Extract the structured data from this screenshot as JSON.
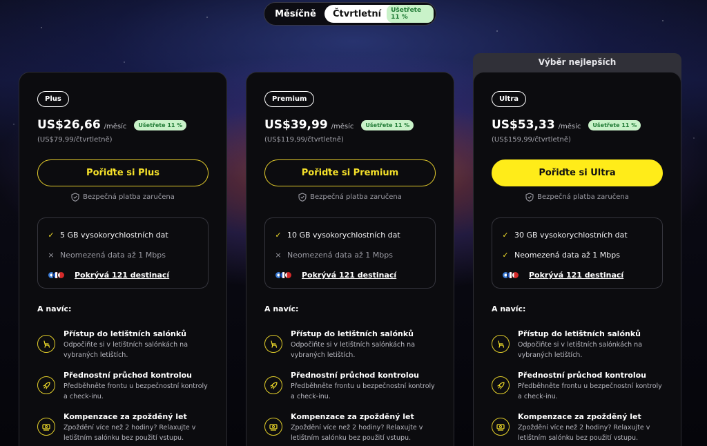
{
  "toggle": {
    "monthly_label": "Měsíčně",
    "quarterly_label": "Čtvrtletní",
    "quarterly_badge": "Ušetřete 11 %"
  },
  "best_banner": "Výběr nejlepších",
  "plans": [
    {
      "tier": "Plus",
      "price": "US$26,66",
      "per": "/měsíc",
      "save_badge": "Ušetřete 11 %",
      "sub_price": "(US$79,99/čtvrtletně)",
      "cta": "Pořiďte si Plus",
      "cta_style": "outline",
      "secure": "Bezpečná platba zaručena",
      "features": [
        {
          "mark": "✓",
          "state": "on",
          "text": "5 GB vysokorychlostních dat"
        },
        {
          "mark": "×",
          "state": "off",
          "text": "Neomezená data až 1 Mbps"
        },
        {
          "mark": "flags",
          "state": "on",
          "text": "Pokrývá 121 destinací"
        }
      ],
      "extra_title": "A navíc:",
      "extras": [
        {
          "icon": "seat-icon",
          "title": "Přístup do letištních salónků",
          "desc": "Odpočiňte si v letištních salónkách na vybraných letištích."
        },
        {
          "icon": "rocket-icon",
          "title": "Přednostní průchod kontrolou",
          "desc": "Předběhněte frontu u bezpečnostní kontroly a check-inu."
        },
        {
          "icon": "money-icon",
          "title": "Kompenzace za zpožděný let",
          "desc": "Zpoždění více než 2 hodiny? Relaxujte v letištním salónku bez použití vstupu."
        }
      ]
    },
    {
      "tier": "Premium",
      "price": "US$39,99",
      "per": "/měsíc",
      "save_badge": "Ušetřete 11 %",
      "sub_price": "(US$119,99/čtvrtletně)",
      "cta": "Pořiďte si Premium",
      "cta_style": "outline",
      "secure": "Bezpečná platba zaručena",
      "features": [
        {
          "mark": "✓",
          "state": "on",
          "text": "10 GB vysokorychlostních dat"
        },
        {
          "mark": "×",
          "state": "off",
          "text": "Neomezená data až 1 Mbps"
        },
        {
          "mark": "flags",
          "state": "on",
          "text": "Pokrývá 121 destinací"
        }
      ],
      "extra_title": "A navíc:",
      "extras": [
        {
          "icon": "seat-icon",
          "title": "Přístup do letištních salónků",
          "desc": "Odpočiňte si v letištních salónkách na vybraných letištích."
        },
        {
          "icon": "rocket-icon",
          "title": "Přednostní průchod kontrolou",
          "desc": "Předběhněte frontu u bezpečnostní kontroly a check-inu."
        },
        {
          "icon": "money-icon",
          "title": "Kompenzace za zpožděný let",
          "desc": "Zpoždění více než 2 hodiny? Relaxujte v letištním salónku bez použití vstupu."
        }
      ]
    },
    {
      "tier": "Ultra",
      "price": "US$53,33",
      "per": "/měsíc",
      "save_badge": "Ušetřete 11 %",
      "sub_price": "(US$159,99/čtvrtletně)",
      "cta": "Pořiďte si Ultra",
      "cta_style": "filled",
      "secure": "Bezpečná platba zaručena",
      "features": [
        {
          "mark": "✓",
          "state": "on",
          "text": "30 GB vysokorychlostních dat"
        },
        {
          "mark": "✓",
          "state": "on",
          "text": "Neomezená data až 1 Mbps"
        },
        {
          "mark": "flags",
          "state": "on",
          "text": "Pokrývá 121 destinací"
        }
      ],
      "extra_title": "A navíc:",
      "extras": [
        {
          "icon": "seat-icon",
          "title": "Přístup do letištních salónků",
          "desc": "Odpočiňte si v letištních salónkách na vybraných letištích."
        },
        {
          "icon": "rocket-icon",
          "title": "Přednostní průchod kontrolou",
          "desc": "Předběhněte frontu u bezpečnostní kontroly a check-inu."
        },
        {
          "icon": "money-icon",
          "title": "Kompenzace za zpožděný let",
          "desc": "Zpoždění více než 2 hodiny? Relaxujte v letištním salónku bez použití vstupu."
        }
      ]
    }
  ],
  "colors": {
    "accent_yellow": "#ffec19",
    "save_badge_bg": "#c9f2c9",
    "save_badge_text": "#1f7a34",
    "card_bg": "#0c0c0f"
  }
}
